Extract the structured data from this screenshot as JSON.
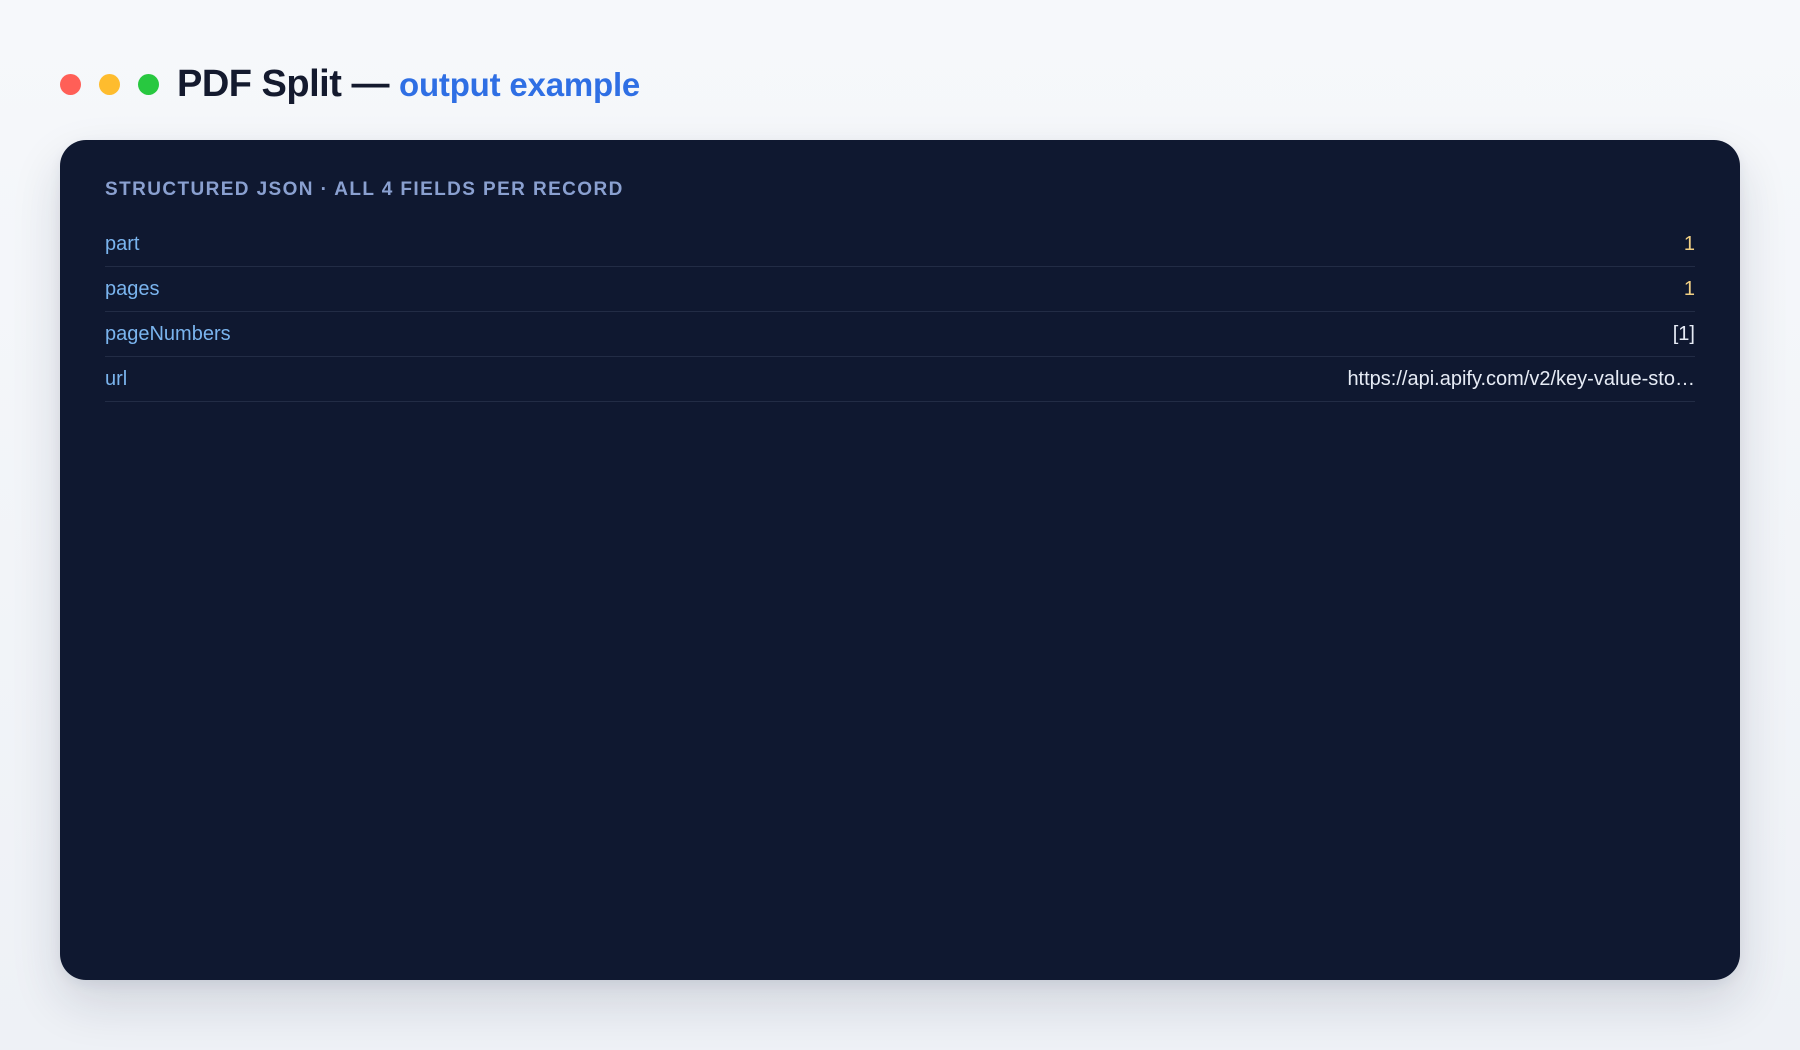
{
  "header": {
    "title": "PDF Split —",
    "subtitle": "output example"
  },
  "window_controls": {
    "close_color": "#ff5f57",
    "minimize_color": "#febc2e",
    "maximize_color": "#28c840"
  },
  "panel": {
    "heading": "STRUCTURED JSON · ALL 4 FIELDS PER RECORD",
    "rows": [
      {
        "key": "part",
        "value": "1",
        "type": "number"
      },
      {
        "key": "pages",
        "value": "1",
        "type": "number"
      },
      {
        "key": "pageNumbers",
        "value": "[1]",
        "type": "array"
      },
      {
        "key": "url",
        "value": "https://api.apify.com/v2/key-value-sto…",
        "type": "string"
      }
    ]
  },
  "colors": {
    "panel_background": "#0f1830",
    "key_color": "#7ab4ee",
    "number_color": "#f0cf83",
    "string_color": "#e6ebf5",
    "accent": "#2f6fe4"
  }
}
